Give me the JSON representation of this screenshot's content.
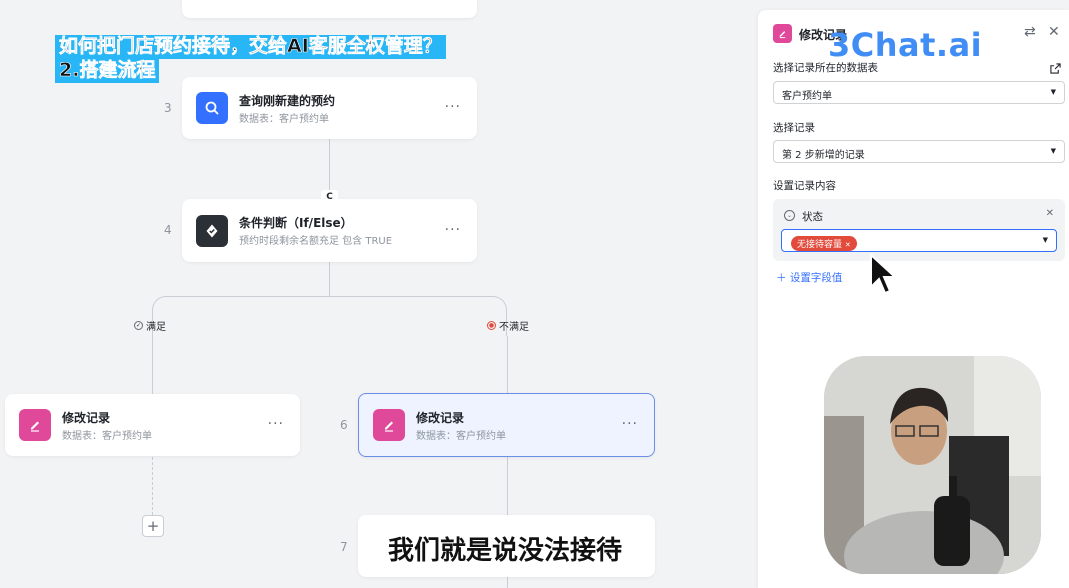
{
  "overlay": {
    "title_line1": "如何把门店预约接待，交给AI客服全权管理？",
    "title_line2": "2.搭建流程",
    "caption": "我们就是说没法接待",
    "brand": "3Chat.ai"
  },
  "canvas": {
    "connector_badge": "C",
    "nodes": [
      {
        "step": "3",
        "title": "查询刚新建的预约",
        "subtitle": "数据表：客户预约单",
        "icon": "search-icon",
        "color": "#3370ff"
      },
      {
        "step": "4",
        "title": "条件判断（If/Else）",
        "subtitle": "预约时段剩余名额充足 包含 TRUE",
        "icon": "check-shield-icon",
        "color": "#2b2f36"
      },
      {
        "step": "",
        "title": "修改记录",
        "subtitle": "数据表：客户预约单",
        "icon": "edit-icon",
        "color": "#e0489a"
      },
      {
        "step": "6",
        "title": "修改记录",
        "subtitle": "数据表：客户预约单",
        "icon": "edit-icon",
        "color": "#e0489a"
      },
      {
        "step": "7",
        "title": "",
        "subtitle": "",
        "icon": "",
        "color": ""
      }
    ],
    "branches": {
      "yes": "满足",
      "no": "不满足"
    },
    "more": "···"
  },
  "panel": {
    "title": "修改记录",
    "table_label": "选择记录所在的数据表",
    "table_value": "客户预约单",
    "record_label": "选择记录",
    "record_value": "第 2 步新增的记录",
    "content_label": "设置记录内容",
    "field_name": "状态",
    "field_tag": "无接待容量",
    "add_field": "设置字段值"
  },
  "colors": {
    "accent": "#3370ff",
    "edit": "#e0489a",
    "tag_red": "#e24a3b",
    "brand_blue": "#3f8df5"
  }
}
